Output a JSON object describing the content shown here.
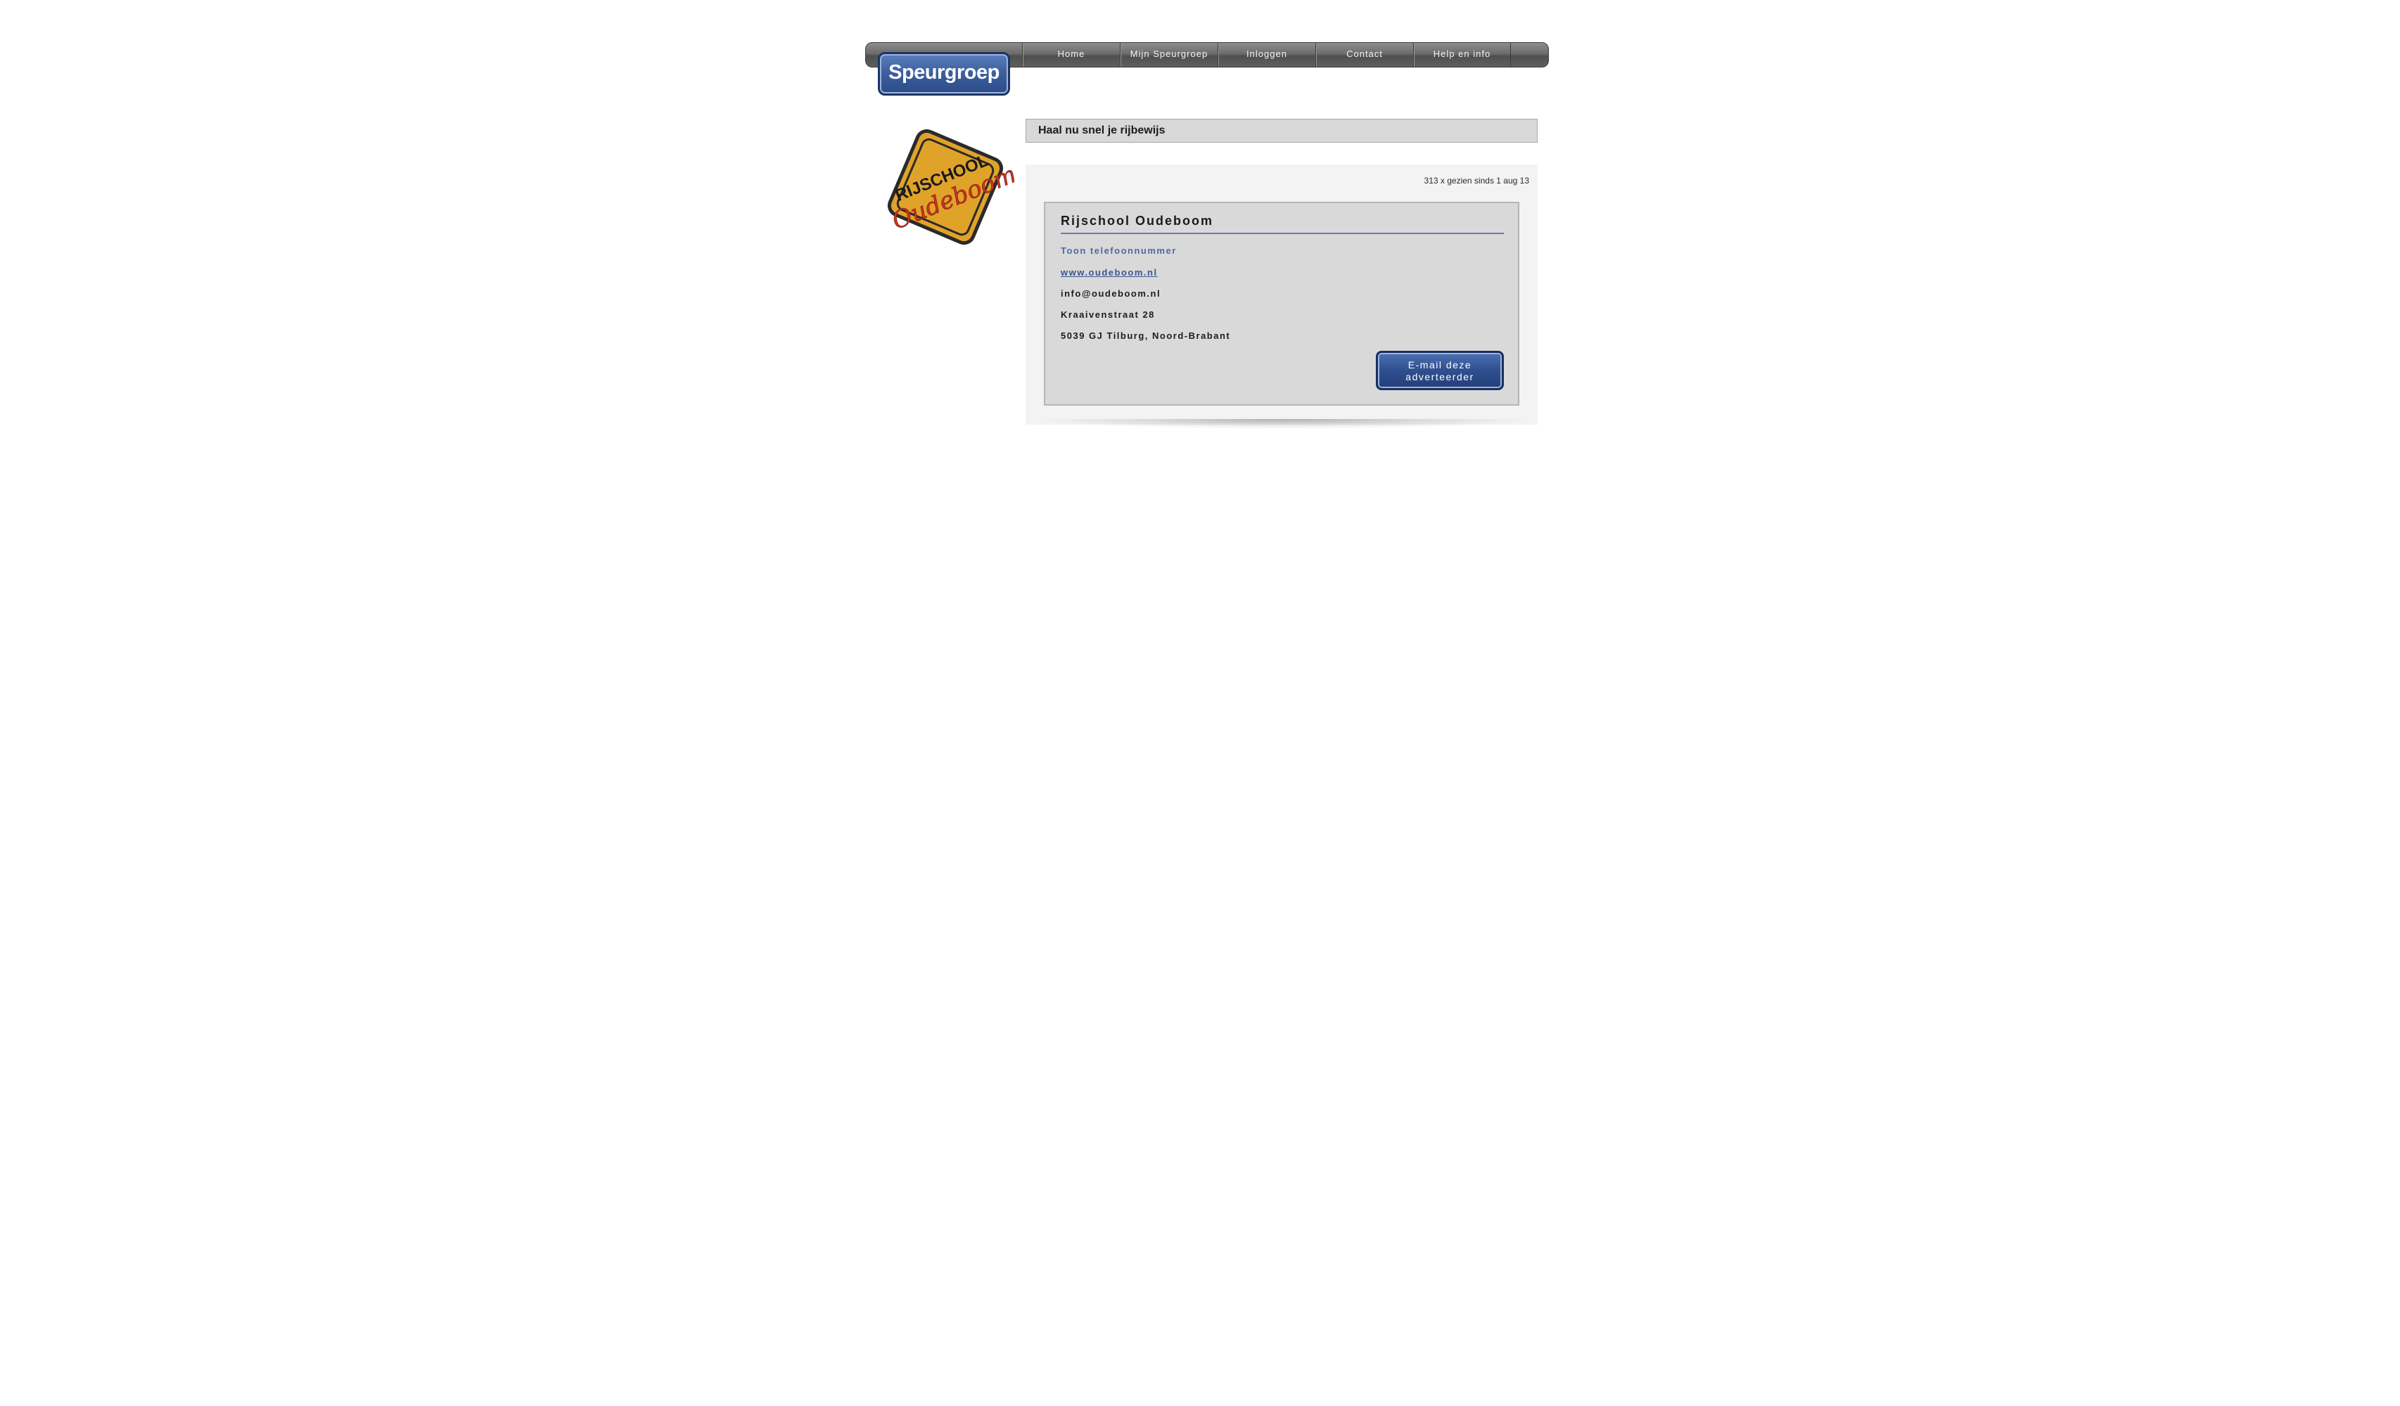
{
  "brand": {
    "logo_text": "Speurgroep"
  },
  "nav": {
    "items": [
      {
        "label": "Home"
      },
      {
        "label": "Mijn Speurgroep"
      },
      {
        "label": "Inloggen"
      },
      {
        "label": "Contact"
      },
      {
        "label": "Help en info"
      }
    ]
  },
  "sign": {
    "top_text": "RIJSCHOOL",
    "script_text": "Oudeboom"
  },
  "listing": {
    "title": "Haal nu snel je rijbewijs",
    "views": "313 x gezien sinds 1 aug 13"
  },
  "advertiser": {
    "name": "Rijschool Oudeboom",
    "phone_link": "Toon telefoonnummer",
    "website": "www.oudeboom.nl",
    "email": "info@oudeboom.nl",
    "street": "Kraaivenstraat 28",
    "city": "5039 GJ Tilburg, Noord-Brabant",
    "email_button": "E-mail deze adverteerder"
  },
  "colors": {
    "brand_blue": "#3c5e9d",
    "nav_gray": "#6c6c6c",
    "sign_yellow": "#e0a32a",
    "sign_script_red": "#c8321e"
  }
}
